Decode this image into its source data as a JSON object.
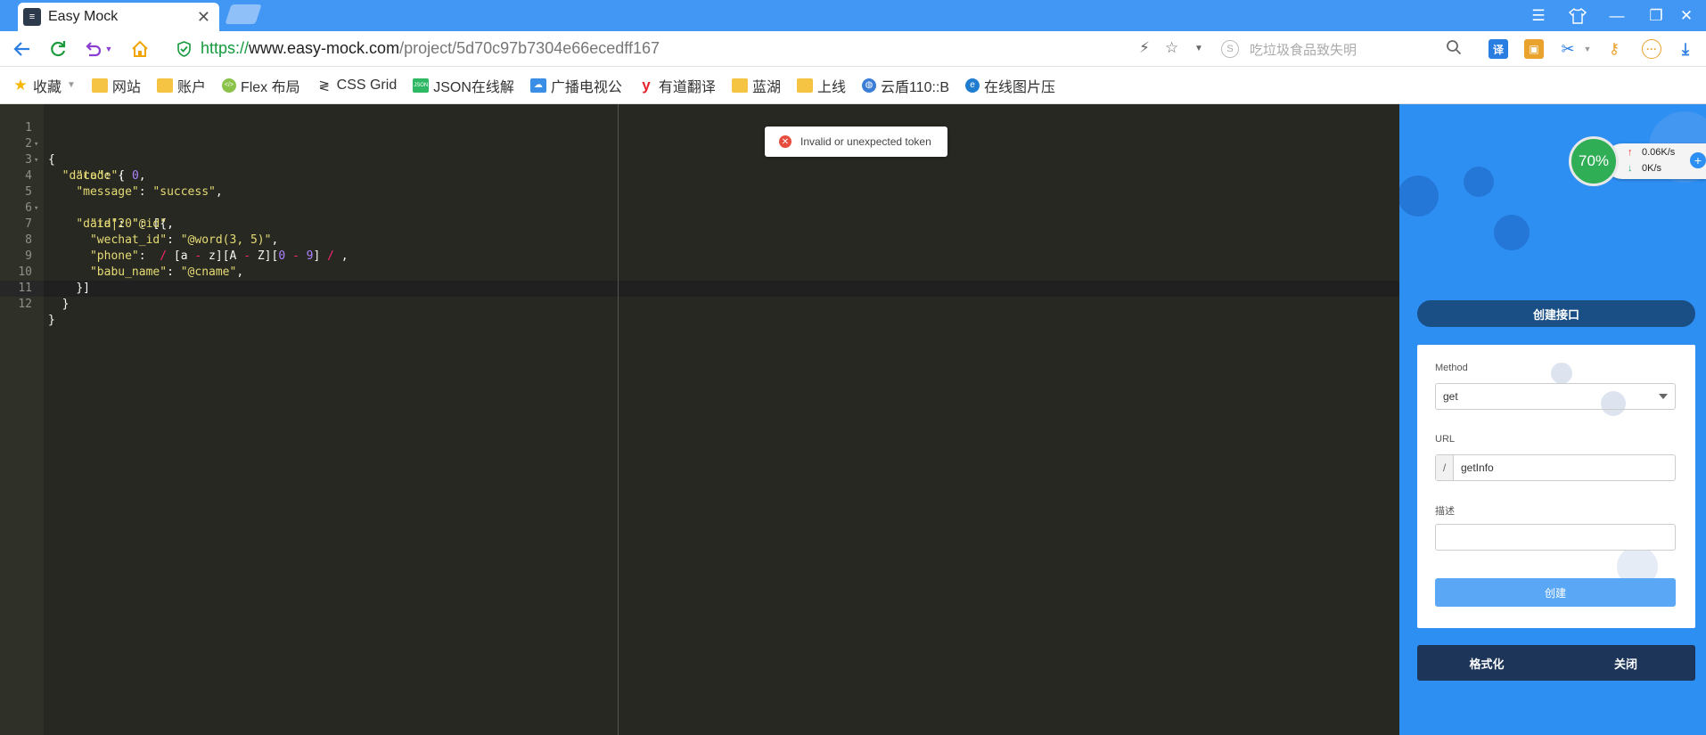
{
  "browser": {
    "tab_title": "Easy Mock",
    "tab_close": "✕",
    "url_scheme": "https://",
    "url_domain": "www.easy-mock.com",
    "url_path": "/project/5d70c97b7304e66ecedff167",
    "search_placeholder": "吃垃圾食品致失明",
    "search_engine_letter": "S"
  },
  "bookmarks": [
    {
      "label": "收藏",
      "icon": "star-icon"
    },
    {
      "label": "网站",
      "icon": "folder-icon"
    },
    {
      "label": "账户",
      "icon": "folder-icon"
    },
    {
      "label": "Flex 布局",
      "icon": "flex-site-icon"
    },
    {
      "label": "CSS Grid",
      "icon": "css-grid-icon"
    },
    {
      "label": "JSON在线解",
      "icon": "json-icon"
    },
    {
      "label": "广播电视公",
      "icon": "cloud-icon"
    },
    {
      "label": "有道翻译",
      "icon": "youdao-icon"
    },
    {
      "label": "蓝湖",
      "icon": "folder-icon"
    },
    {
      "label": "上线",
      "icon": "folder-icon"
    },
    {
      "label": "云盾110::B",
      "icon": "globe-icon"
    },
    {
      "label": "在线图片压",
      "icon": "compress-icon"
    }
  ],
  "editor": {
    "line_numbers": [
      "1",
      "2",
      "3",
      "4",
      "5",
      "6",
      "7",
      "8",
      "9",
      "10",
      "11",
      "12"
    ],
    "code": {
      "l1": "{",
      "l2_key": "\"data\"",
      "l2_rest": ": {",
      "l3_key": "\"code\"",
      "l3_colon": ": ",
      "l3_val": "0",
      "l3_end": ",",
      "l4_key": "\"message\"",
      "l4_colon": ": ",
      "l4_val": "\"success\"",
      "l4_end": ",",
      "l5_key": "\"data|20\"",
      "l5_rest": ": [{",
      "l6_key": "\"id\"",
      "l6_colon": ": ",
      "l6_val": "\"@id\"",
      "l6_end": ",",
      "l7_key": "\"wechat_id\"",
      "l7_colon": ": ",
      "l7_val": "\"@word(3, 5)\"",
      "l7_end": ",",
      "l8_key": "\"phone\"",
      "l8_colon": ":  ",
      "l8_slash1": "/",
      "l8_a": " [a ",
      "l8_dash1": "-",
      "l8_b": " z][A ",
      "l8_dash2": "-",
      "l8_c": " Z][",
      "l8_zero": "0",
      "l8_sp": " ",
      "l8_dash3": "-",
      "l8_sp2": " ",
      "l8_nine": "9",
      "l8_d": "] ",
      "l8_slash2": "/",
      "l8_end": " ,",
      "l9_key": "\"babu_name\"",
      "l9_colon": ": ",
      "l9_val": "\"@cname\"",
      "l9_end": ",",
      "l10": "}]",
      "l11": "}",
      "l12": "}"
    }
  },
  "toast": {
    "icon": "error-icon",
    "message": "Invalid or unexpected token"
  },
  "speed_widget": {
    "percent": "70%",
    "upload": "0.06K/s",
    "download": "0K/s"
  },
  "panel": {
    "title": "创建接口",
    "method_label": "Method",
    "method_value": "get",
    "url_label": "URL",
    "url_prefix": "/",
    "url_value": "getInfo",
    "desc_label": "描述",
    "desc_value": "",
    "create_button": "创建",
    "format_button": "格式化",
    "close_button": "关闭"
  },
  "colors": {
    "tab_bar": "#4197f3",
    "panel_bg": "#2e8ff3",
    "editor_bg": "#272822",
    "string": "#e6db74",
    "number": "#ae81ff",
    "operator": "#f92672"
  }
}
